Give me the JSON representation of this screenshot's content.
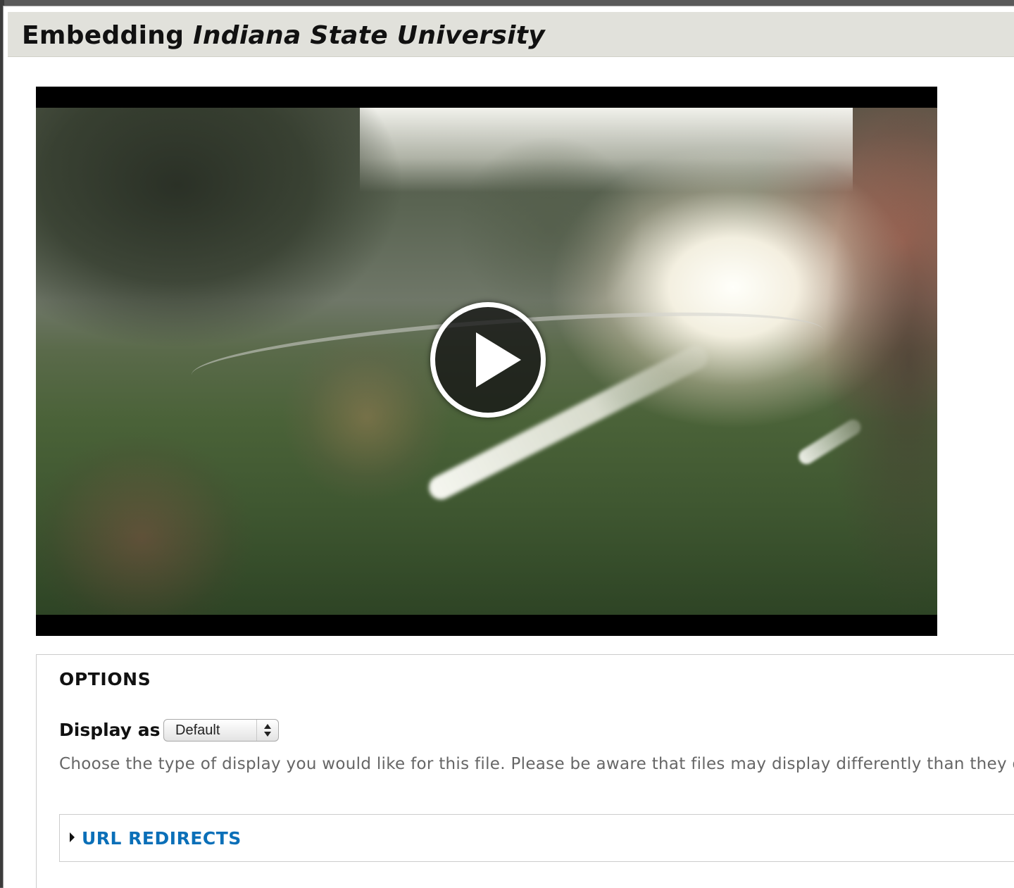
{
  "dialog": {
    "title_prefix": "Embedding",
    "file_name": "Indiana State University"
  },
  "video": {
    "play_icon": "play-icon"
  },
  "options": {
    "legend": "OPTIONS",
    "display_as_label": "Display as",
    "display_as_value": "Default",
    "display_as_icon": "select-arrows-icon",
    "description": "Choose the type of display you would like for this file. Please be aware that files may display differently than they do"
  },
  "url_redirects": {
    "label": "URL REDIRECTS",
    "toggle_icon": "caret-right-icon"
  },
  "colors": {
    "titlebar_bg": "#e1e1db",
    "link": "#0a6fb8",
    "description_text": "#666666"
  }
}
